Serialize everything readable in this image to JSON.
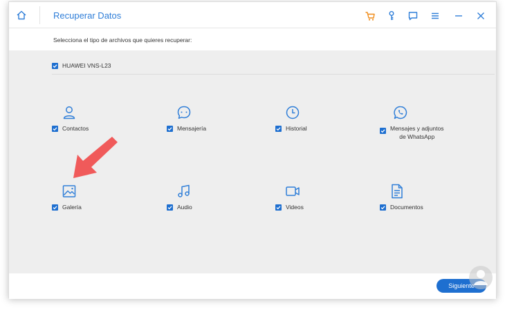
{
  "window": {
    "title": "Recuperar Datos",
    "accent_color": "#2f7ed8",
    "cart_color": "#f08c1a"
  },
  "toolbar": {
    "icons": [
      "home-icon",
      "cart-icon",
      "key-icon",
      "chat-icon",
      "menu-icon",
      "minimize-icon",
      "close-icon"
    ]
  },
  "main": {
    "subtitle": "Selecciona el tipo de archivos que quieres recuperar:",
    "device": {
      "label": "HUAWEI VNS-L23",
      "checked": true
    },
    "items": [
      {
        "label": "Contactos",
        "icon": "contacts-icon",
        "checked": true
      },
      {
        "label": "Mensajería",
        "icon": "messaging-icon",
        "checked": true
      },
      {
        "label": "Historial",
        "icon": "history-icon",
        "checked": true
      },
      {
        "label_line1": "Mensajes y adjuntos",
        "label_line2": "de WhatsApp",
        "icon": "whatsapp-icon",
        "checked": true
      },
      {
        "label": "Galería",
        "icon": "gallery-icon",
        "checked": true
      },
      {
        "label": "Audio",
        "icon": "audio-icon",
        "checked": true
      },
      {
        "label": "Videos",
        "icon": "video-icon",
        "checked": true
      },
      {
        "label": "Documentos",
        "icon": "document-icon",
        "checked": true
      }
    ]
  },
  "footer": {
    "next_label": "Siguiente"
  },
  "annotation": {
    "arrow_color": "#f05a5a"
  }
}
